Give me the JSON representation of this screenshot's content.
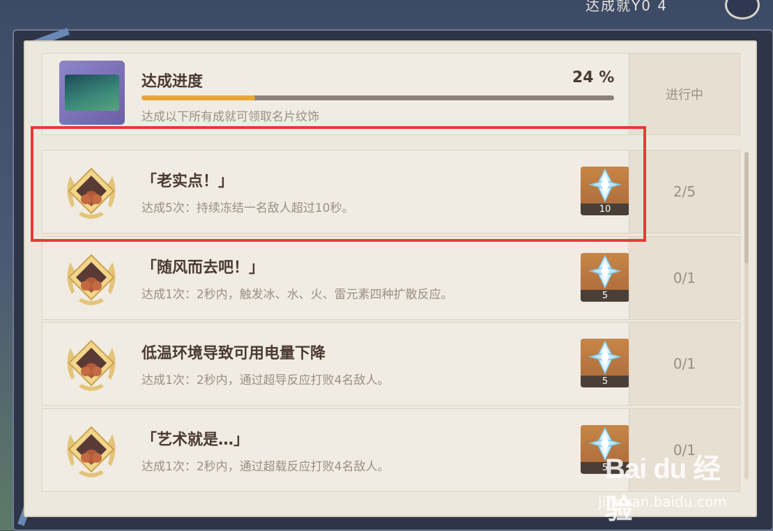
{
  "header": {
    "partial_title": "达成就Y0 4"
  },
  "summary": {
    "title": "达成进度",
    "percent_label": "24 %",
    "progress_fraction": 0.24,
    "description": "达成以下所有成就可领取名片纹饰",
    "status": "进行中"
  },
  "achievements": [
    {
      "title": "「老实点！」",
      "description": "达成5次：持续冻结一名敌人超过10秒。",
      "reward_count": "10",
      "progress": "2/5"
    },
    {
      "title": "「随风而去吧！」",
      "description": "达成1次：2秒内，触发冰、水、火、雷元素四种扩散反应。",
      "reward_count": "5",
      "progress": "0/1"
    },
    {
      "title": "低温环境导致可用电量下降",
      "description": "达成1次：2秒内，通过超导反应打败4名敌人。",
      "reward_count": "5",
      "progress": "0/1"
    },
    {
      "title": "「艺术就是…」",
      "description": "达成1次：2秒内，通过超载反应打败4名敌人。",
      "reward_count": "5",
      "progress": "0/1"
    }
  ],
  "icons": {
    "badge": "laurel-badge-icon",
    "reward": "primogem-icon"
  },
  "colors": {
    "highlight": "#e8393b",
    "progress_fill": "#e8a838"
  },
  "watermark": {
    "logo": "Bai du 经验",
    "url": "jingyan.baidu.com"
  }
}
